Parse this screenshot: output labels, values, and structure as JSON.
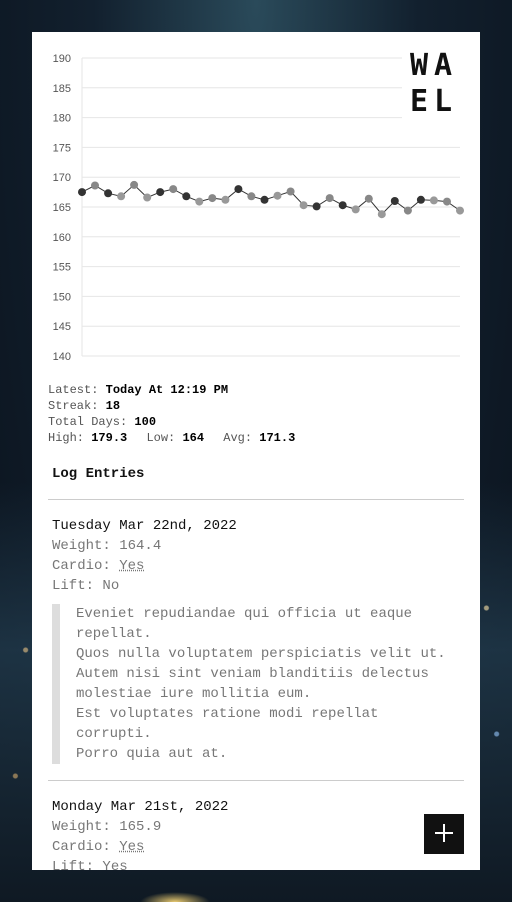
{
  "brand": {
    "logo_text": "WAEL"
  },
  "chart_data": {
    "type": "line",
    "yticks": [
      "190",
      "185",
      "180",
      "175",
      "170",
      "165",
      "160",
      "155",
      "150",
      "145",
      "140"
    ],
    "ylim": [
      140,
      190
    ],
    "grid": true,
    "series": [
      {
        "values": [
          167.5,
          168.6,
          167.3,
          166.8,
          168.7,
          166.6,
          167.5,
          168.0,
          166.8,
          165.9,
          166.5,
          166.2,
          168.0,
          166.8,
          166.2,
          166.9,
          167.6,
          165.3,
          165.1,
          166.5,
          165.3,
          164.6,
          166.4,
          163.8,
          166.0,
          164.4,
          166.2,
          166.1,
          165.9,
          164.4
        ]
      }
    ]
  },
  "stats": {
    "latest_label": "Latest:",
    "latest_value": "Today At 12:19 PM",
    "streak_label": "Streak:",
    "streak_value": "18",
    "total_label": "Total Days:",
    "total_value": "100",
    "high_label": "High:",
    "high_value": "179.3",
    "low_label": "Low:",
    "low_value": "164",
    "avg_label": "Avg:",
    "avg_value": "171.3"
  },
  "log": {
    "title": "Log Entries",
    "entries": [
      {
        "date": "Tuesday Mar 22nd, 2022",
        "weight_label": "Weight:",
        "weight": "164.4",
        "cardio_label": "Cardio:",
        "cardio": "Yes",
        "lift_label": "Lift:",
        "lift": "No",
        "notes": [
          "Eveniet repudiandae qui officia ut eaque repellat.",
          "Quos nulla voluptatem perspiciatis velit ut.",
          "Autem nisi sint veniam blanditiis delectus molestiae iure mollitia eum.",
          "Est voluptates ratione modi repellat corrupti.",
          "Porro quia aut at."
        ]
      },
      {
        "date": "Monday Mar 21st, 2022",
        "weight_label": "Weight:",
        "weight": "165.9",
        "cardio_label": "Cardio:",
        "cardio": "Yes",
        "lift_label": "Lift:",
        "lift": "Yes"
      }
    ]
  },
  "fab": {
    "icon": "plus-icon"
  }
}
